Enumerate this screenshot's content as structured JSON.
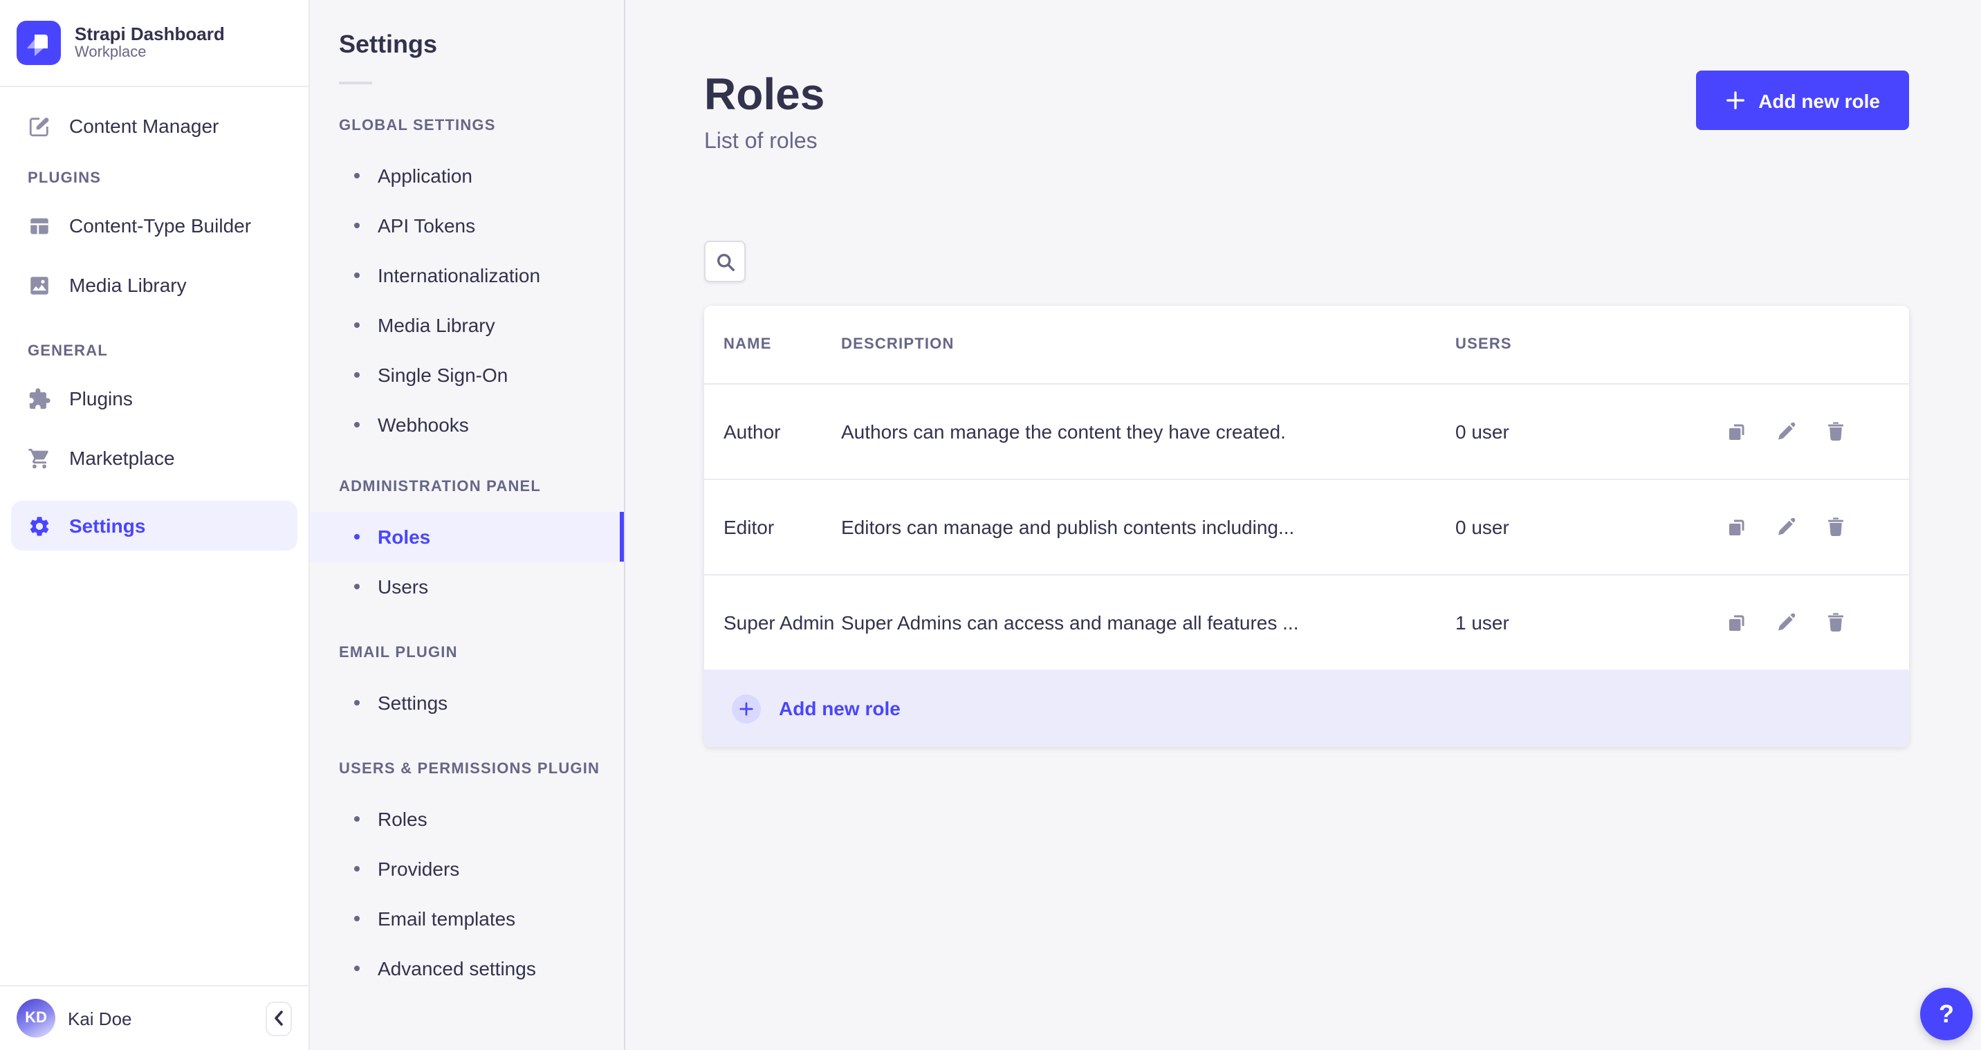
{
  "app": {
    "title": "Strapi Dashboard",
    "subtitle": "Workplace"
  },
  "main_nav": {
    "content_manager": {
      "label": "Content Manager",
      "icon": "edit-pen-icon"
    },
    "sections": [
      {
        "title": "PLUGINS",
        "items": [
          {
            "label": "Content-Type Builder",
            "icon": "layout-icon"
          },
          {
            "label": "Media Library",
            "icon": "image-icon"
          }
        ]
      },
      {
        "title": "GENERAL",
        "items": [
          {
            "label": "Plugins",
            "icon": "puzzle-icon"
          },
          {
            "label": "Marketplace",
            "icon": "cart-icon"
          },
          {
            "label": "Settings",
            "icon": "gear-icon",
            "active": true
          }
        ]
      }
    ],
    "user": {
      "initials": "KD",
      "name": "Kai Doe"
    },
    "collapse_icon": "chevron-left-icon"
  },
  "subnav": {
    "title": "Settings",
    "sections": [
      {
        "title": "GLOBAL SETTINGS",
        "items": [
          {
            "label": "Application"
          },
          {
            "label": "API Tokens"
          },
          {
            "label": "Internationalization"
          },
          {
            "label": "Media Library"
          },
          {
            "label": "Single Sign-On"
          },
          {
            "label": "Webhooks"
          }
        ]
      },
      {
        "title": "ADMINISTRATION PANEL",
        "items": [
          {
            "label": "Roles",
            "active": true
          },
          {
            "label": "Users"
          }
        ]
      },
      {
        "title": "EMAIL PLUGIN",
        "items": [
          {
            "label": "Settings"
          }
        ]
      },
      {
        "title": "USERS & PERMISSIONS PLUGIN",
        "items": [
          {
            "label": "Roles"
          },
          {
            "label": "Providers"
          },
          {
            "label": "Email templates"
          },
          {
            "label": "Advanced settings"
          }
        ]
      }
    ]
  },
  "page": {
    "title": "Roles",
    "subtitle": "List of roles",
    "add_button_label": "Add new role",
    "table": {
      "headers": [
        "NAME",
        "DESCRIPTION",
        "USERS"
      ],
      "rows": [
        {
          "name": "Author",
          "description": "Authors can manage the content they have created.",
          "users": "0 user"
        },
        {
          "name": "Editor",
          "description": "Editors can manage and publish contents including...",
          "users": "0 user"
        },
        {
          "name": "Super Admin",
          "description": "Super Admins can access and manage all features ...",
          "users": "1 user"
        }
      ],
      "row_action_icons": [
        "duplicate-icon",
        "edit-icon",
        "delete-icon"
      ],
      "footer_add_label": "Add new role"
    },
    "help_label": "?"
  },
  "colors": {
    "primary": "#4945ff",
    "primary_light_bg": "#f0f0ff",
    "footer_bg": "#ecebfc",
    "plus_circle_bg": "#d9d8ff",
    "page_bg": "#f6f6f9",
    "surface": "#ffffff",
    "border": "#eaeaef",
    "input_border": "#dcdce4",
    "icon_gray": "#8e8ea9",
    "text_primary": "#32324d",
    "text_secondary": "#666687"
  }
}
